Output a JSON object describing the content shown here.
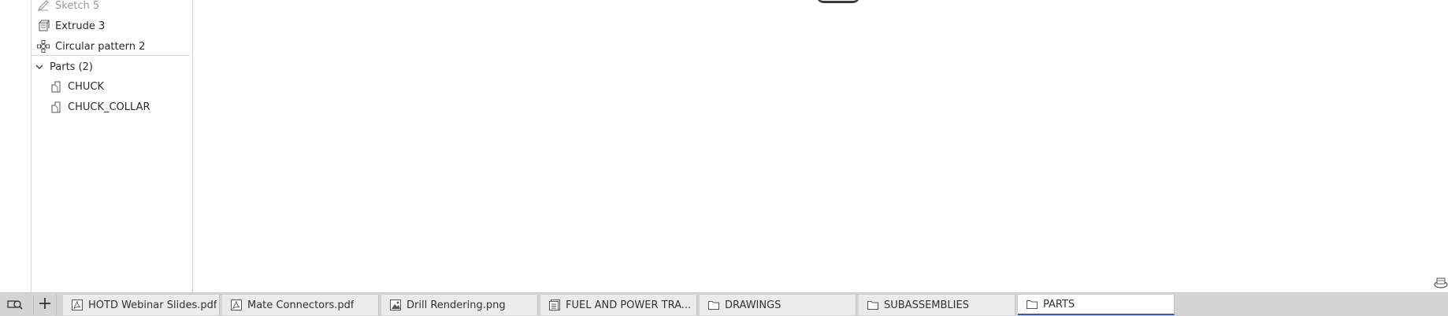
{
  "feature_tree": {
    "items": [
      {
        "label": "Sketch 5",
        "icon": "sketch-icon",
        "state": "suppressed"
      },
      {
        "label": "Extrude 3",
        "icon": "extrude-icon"
      },
      {
        "label": "Circular pattern 2",
        "icon": "circular-pattern-icon"
      }
    ],
    "parts_group": {
      "label": "Parts (2)",
      "expanded": true,
      "parts": [
        {
          "label": "CHUCK",
          "icon": "part-icon"
        },
        {
          "label": "CHUCK_COLLAR",
          "icon": "part-icon"
        }
      ]
    }
  },
  "tabs": [
    {
      "label": "HOTD Webinar Slides.pdf",
      "icon": "pdf-icon"
    },
    {
      "label": "Mate Connectors.pdf",
      "icon": "pdf-icon"
    },
    {
      "label": "Drill Rendering.png",
      "icon": "image-icon"
    },
    {
      "label": "FUEL AND POWER TRA...",
      "icon": "document-icon"
    },
    {
      "label": "DRAWINGS",
      "icon": "folder-icon"
    },
    {
      "label": "SUBASSEMBLIES",
      "icon": "folder-icon"
    },
    {
      "label": "PARTS",
      "icon": "folder-icon",
      "active": true
    }
  ],
  "colors": {
    "active_tab_underline": "#2f5fb3",
    "tabbar_bg": "#d4d4d4"
  }
}
